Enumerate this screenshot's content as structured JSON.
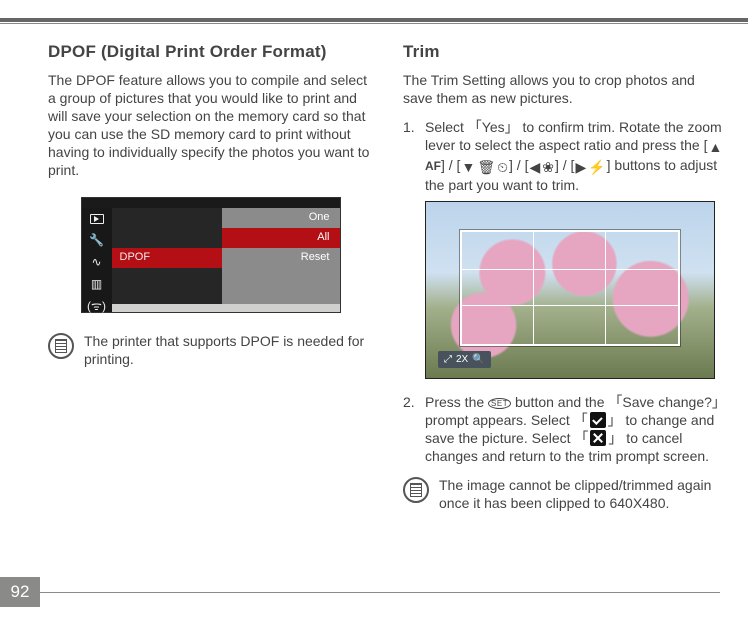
{
  "page_number": "92",
  "left": {
    "heading": "DPOF (Digital Print Order Format)",
    "intro": "The DPOF feature allows you to compile and select a group of pictures that you would like to print and will save your selection on the memory card so that you can use the SD memory card to print without having to individually specify the photos you want to print.",
    "menu": {
      "rows": [
        {
          "left": "",
          "right": "One"
        },
        {
          "left": "",
          "right": "All"
        },
        {
          "left": "DPOF",
          "right": "Reset"
        }
      ]
    },
    "note": "The printer that supports DPOF is needed for printing."
  },
  "right": {
    "heading": "Trim",
    "intro": "The Trim Setting allows you to crop photos and save them as new pictures.",
    "step1_num": "1.",
    "step1_a": "Select 「Yes」 to confirm trim. Rotate the zoom lever to select the aspect ratio and press the [",
    "step1_af": "AF",
    "step1_b": "] / [",
    "step1_c": "] / [",
    "step1_d": "] / [",
    "step1_e": "] buttons to adjust the part you want to trim.",
    "zoom_label": "2X",
    "step2_num": "2.",
    "step2_a": "Press the ",
    "step2_set": "SET",
    "step2_b": " button and the 「Save change?」 prompt appears. Select 「",
    "step2_c": "」 to change and save the picture. Select 「",
    "step2_d": "」 to cancel changes and return to the trim prompt screen.",
    "note": "The image cannot be clipped/trimmed again once it has been clipped to 640X480."
  }
}
